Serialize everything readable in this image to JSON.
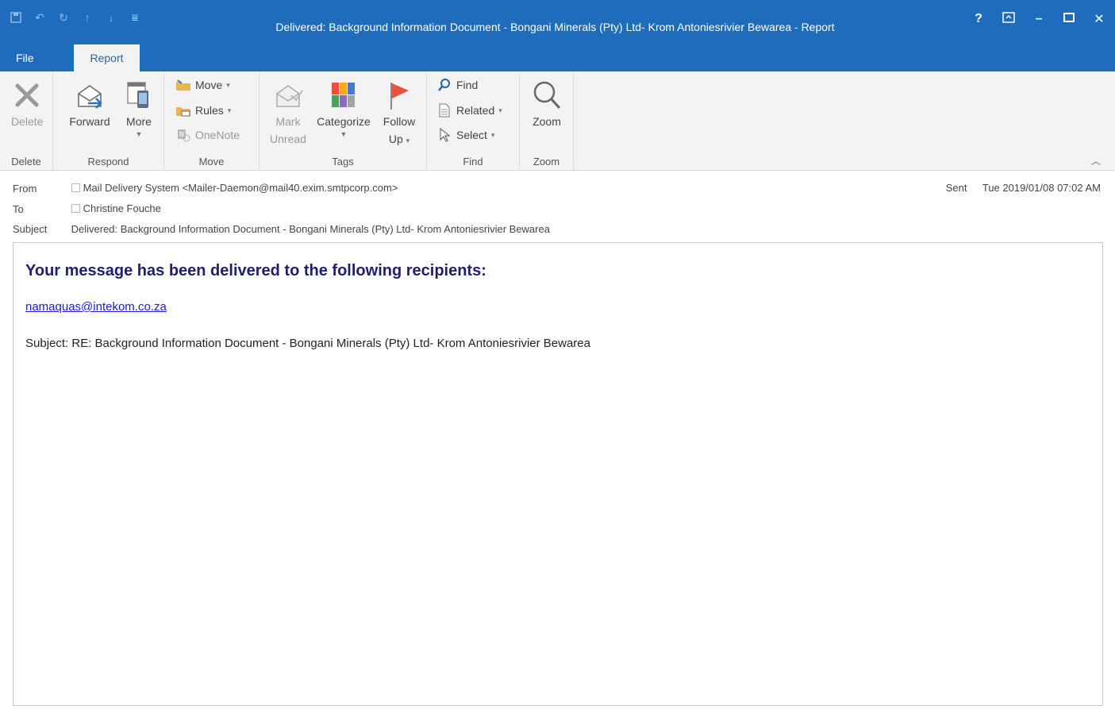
{
  "window": {
    "title": "Delivered: Background Information Document - Bongani Minerals (Pty) Ltd- Krom Antoniesrivier Bewarea - Report",
    "controls": [
      "?",
      "⧉",
      "–",
      "□",
      "✕"
    ]
  },
  "tabs": [
    {
      "label": "File"
    },
    {
      "label": "Report"
    }
  ],
  "ribbon": {
    "groups": {
      "delete": {
        "label": "Delete",
        "button": "Delete"
      },
      "respond": {
        "label": "Respond",
        "forward": "Forward",
        "more": "More"
      },
      "move": {
        "label": "Move",
        "move": "Move",
        "rules": "Rules",
        "onenote": "OneNote"
      },
      "tags": {
        "label": "Tags",
        "mark_unread_1": "Mark",
        "mark_unread_2": "Unread",
        "categorize": "Categorize",
        "follow_up_1": "Follow",
        "follow_up_2": "Up"
      },
      "find": {
        "label": "Find",
        "find": "Find",
        "related": "Related",
        "select": "Select"
      },
      "zoom": {
        "label": "Zoom",
        "button": "Zoom"
      }
    }
  },
  "message": {
    "from_label": "From",
    "from_value": "Mail Delivery System <Mailer-Daemon@mail40.exim.smtpcorp.com>",
    "to_label": "To",
    "to_value": "Christine Fouche",
    "subject_label": "Subject",
    "subject_value": "Delivered: Background Information Document - Bongani Minerals (Pty) Ltd- Krom Antoniesrivier Bewarea",
    "sent_label": "Sent",
    "sent_value": "Tue 2019/01/08 07:02 AM"
  },
  "body": {
    "heading": "Your message has been delivered to the following recipients:",
    "recipient": "namaquas@intekom.co.za",
    "subject_line": "Subject: RE: Background Information Document - Bongani Minerals (Pty) Ltd- Krom Antoniesrivier Bewarea"
  },
  "colors": {
    "titlebar": "#1e6cbb",
    "ribbon": "#f3f3f3",
    "heading": "#1f1f6b",
    "link": "#1a1ad8"
  }
}
